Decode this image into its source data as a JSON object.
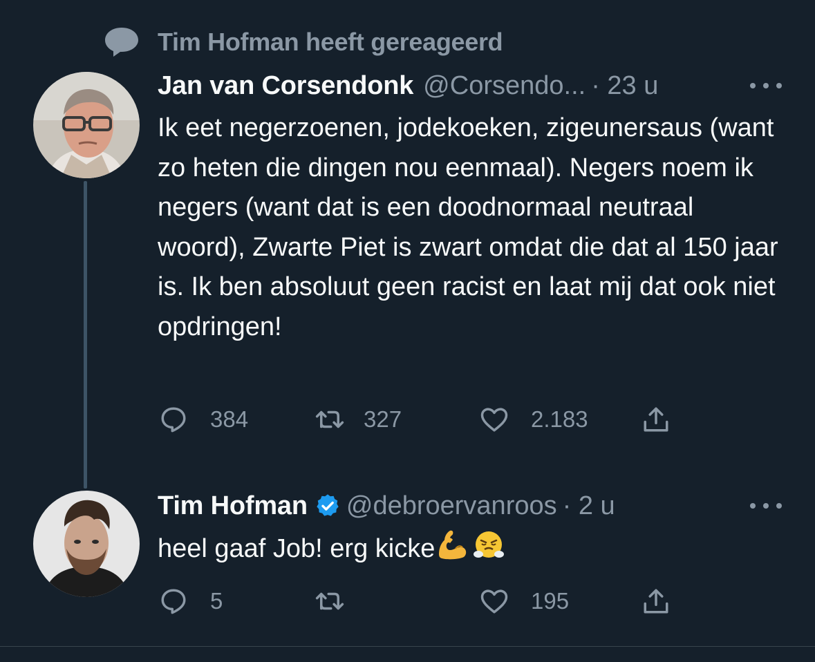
{
  "context": {
    "icon": "reply-bubble-icon",
    "text": "Tim Hofman heeft gereageerd"
  },
  "tweets": [
    {
      "name": "Jan van Corsendonk",
      "handle": "@Corsendo...",
      "time": "· 23 u",
      "text": "Ik eet negerzoenen, jodekoeken, zigeunersaus (want zo heten die dingen nou eenmaal). Negers noem ik negers (want dat is een doodnormaal neutraal woord), Zwarte Piet is zwart omdat die dat al 150 jaar is. Ik ben absoluut geen racist en laat mij dat ook niet opdringen!",
      "replies": "384",
      "retweets": "327",
      "likes": "2.183"
    },
    {
      "name": "Tim Hofman",
      "verified": true,
      "handle": "@debroervanroos",
      "time": "· 2 u",
      "text": "heel gaaf Job! erg kicke",
      "emojis": [
        "flexed-biceps-emoji",
        "face-with-steam-emoji"
      ],
      "replies": "5",
      "retweets": "",
      "likes": "195"
    }
  ],
  "colors": {
    "background": "#15202b",
    "primary_text": "#f7f9f9",
    "secondary_text": "#8b98a5",
    "verified": "#1d9bf0",
    "thread_line": "#3d5466"
  }
}
